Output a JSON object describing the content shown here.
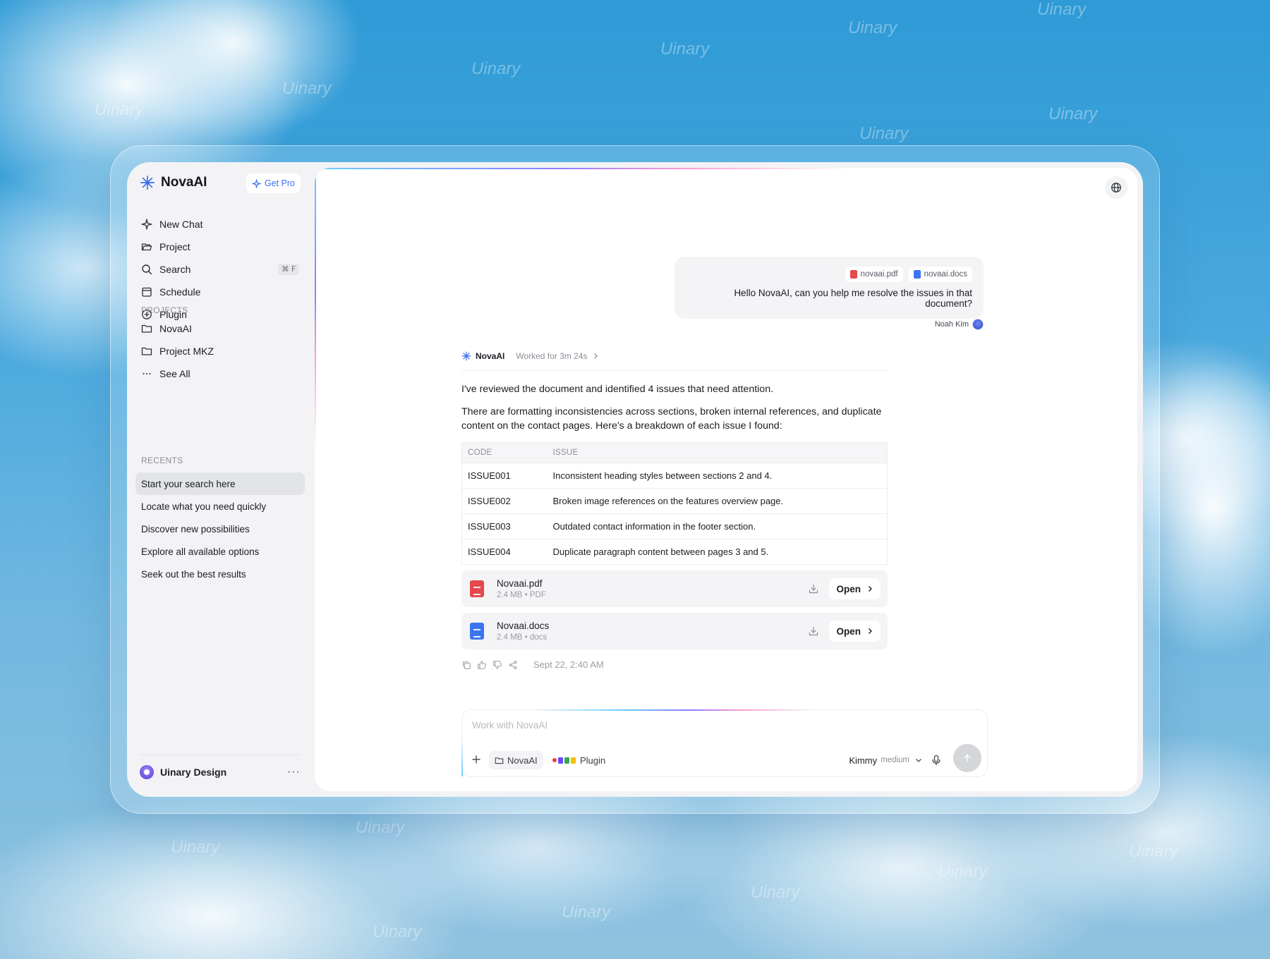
{
  "background": {
    "watermark_text": "Uinary"
  },
  "brand": {
    "name": "NovaAI",
    "get_pro_label": "Get Pro",
    "accent_color": "#3a6df0"
  },
  "nav": {
    "items": [
      {
        "label": "New Chat",
        "icon": "sparkle-icon"
      },
      {
        "label": "Project",
        "icon": "folder-open-icon"
      },
      {
        "label": "Search",
        "icon": "search-icon",
        "shortcut": "⌘ F"
      },
      {
        "label": "Schedule",
        "icon": "calendar-icon"
      },
      {
        "label": "Plugin",
        "icon": "plus-circle-icon"
      }
    ]
  },
  "projects": {
    "heading": "PROJECTS",
    "items": [
      "NovaAI",
      "Project MKZ"
    ],
    "see_all_label": "See All"
  },
  "recents": {
    "heading": "RECENTS",
    "items": [
      "Start your search here",
      "Locate what you need quickly",
      "Discover new possibilities",
      "Explore all available options",
      "Seek out the best results"
    ]
  },
  "workspace": {
    "name": "Uinary Design",
    "more_label": "···"
  },
  "conversation": {
    "user_message": {
      "attachments": [
        {
          "name": "novaai.pdf",
          "type": "pdf"
        },
        {
          "name": "novaai.docs",
          "type": "docs"
        }
      ],
      "text": "Hello NovaAI, can you help me resolve the issues in that document?",
      "author": "Noah Kim"
    },
    "ai_message": {
      "name": "NovaAI",
      "worked_label": "Worked for 3m 24s",
      "paragraph_1": "I've reviewed the document and identified 4 issues that need attention.",
      "paragraph_2": "There are formatting inconsistencies across sections, broken internal references, and duplicate content on the contact pages. Here's a breakdown of each issue I found:",
      "table": {
        "headers": [
          "CODE",
          "ISSUE"
        ],
        "rows": [
          [
            "ISSUE001",
            "Inconsistent heading styles between sections 2 and 4."
          ],
          [
            "ISSUE002",
            "Broken image references on the features overview page."
          ],
          [
            "ISSUE003",
            "Outdated contact information in the footer section."
          ],
          [
            "ISSUE004",
            "Duplicate paragraph content between pages 3 and 5."
          ]
        ]
      },
      "files": [
        {
          "name": "Novaai.pdf",
          "meta": "2.4 MB • PDF",
          "open_label": "Open",
          "color": "#e5484d"
        },
        {
          "name": "Novaai.docs",
          "meta": "2.4 MB • docs",
          "open_label": "Open",
          "color": "#3b74ef"
        }
      ],
      "timestamp": "Sept 22, 2:40 AM"
    }
  },
  "composer": {
    "placeholder": "Work with NovaAI",
    "project_label": "NovaAI",
    "plugin_label": "Plugin",
    "model_name": "Kimmy",
    "model_level": "medium"
  }
}
